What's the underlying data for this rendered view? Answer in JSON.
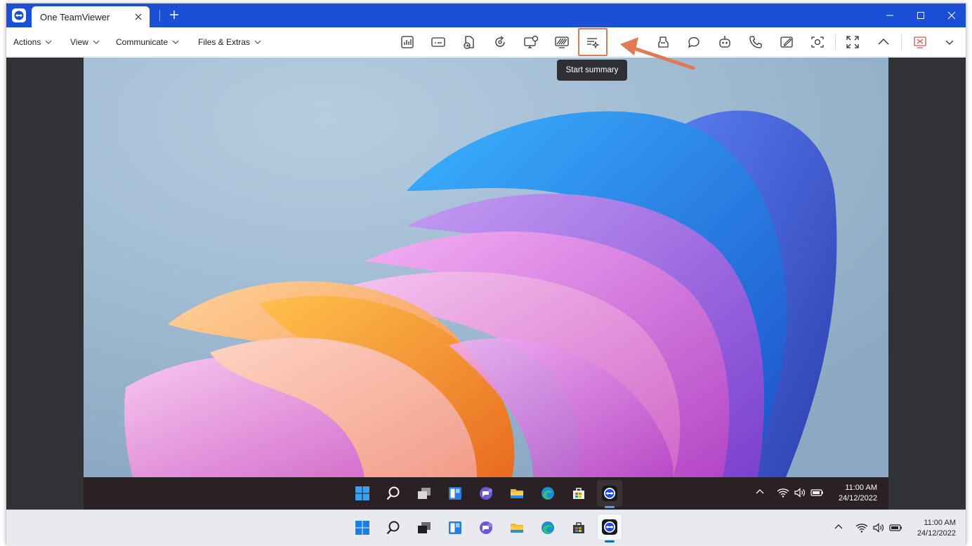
{
  "window": {
    "tab_title": "One TeamViewer",
    "brand_color": "#1a4fd6"
  },
  "menu": {
    "actions": "Actions",
    "view": "View",
    "communicate": "Communicate",
    "files_extras": "Files & Extras"
  },
  "toolbar": {
    "tools": [
      "session-stats",
      "remote-keyboard",
      "file-transfer",
      "remote-refresh",
      "screen-share",
      "black-screen",
      "start-summary",
      "clipboard",
      "chat",
      "assistant-bot",
      "call",
      "whiteboard",
      "screenshot",
      "fullscreen",
      "collapse",
      "end-session",
      "more"
    ],
    "highlight_color": "#e07a55"
  },
  "tooltip": {
    "text": "Start summary"
  },
  "remote_taskbar": {
    "time": "11:00 AM",
    "date": "24/12/2022"
  },
  "local_taskbar": {
    "time": "11:00 AM",
    "date": "24/12/2022"
  }
}
